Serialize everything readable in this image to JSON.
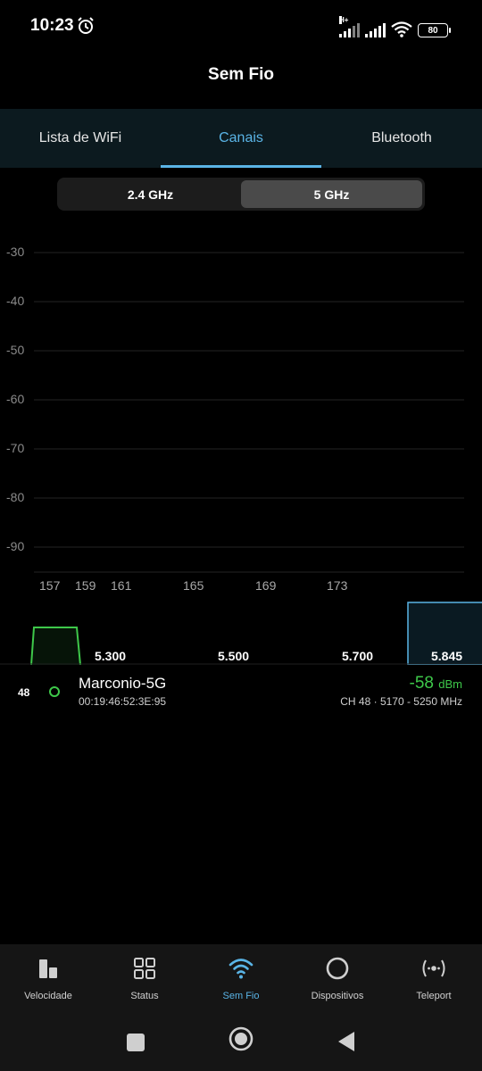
{
  "status_bar": {
    "time": "10:23",
    "network_type": "H+",
    "battery": "80"
  },
  "header": {
    "title": "Sem Fio"
  },
  "tabs": [
    {
      "label": "Lista de WiFi",
      "active": false
    },
    {
      "label": "Canais",
      "active": true
    },
    {
      "label": "Bluetooth",
      "active": false
    }
  ],
  "band_selector": {
    "options": [
      "2.4 GHz",
      "5 GHz"
    ],
    "selected": "5 GHz"
  },
  "chart_data": {
    "type": "area",
    "y_ticks": [
      "-30",
      "-40",
      "-50",
      "-60",
      "-70",
      "-80",
      "-90"
    ],
    "ylim": [
      -95,
      -25
    ],
    "channel_ticks": [
      "157",
      "159",
      "161",
      "165",
      "169",
      "173"
    ],
    "frequency_ticks": [
      "5.300",
      "5.500",
      "5.700",
      "5.845"
    ],
    "series": [
      {
        "channel": 48,
        "signal_dbm": -58,
        "freq_range_mhz": [
          5170,
          5250
        ],
        "color": "#3ec84a"
      }
    ],
    "highlight_color": "#5ab4e6",
    "grid": true
  },
  "networks": [
    {
      "channel": "48",
      "ssid": "Marconio-5G",
      "mac": "00:19:46:52:3E:95",
      "signal": "-58",
      "signal_unit": "dBm",
      "info": "CH 48 · 5170 - 5250 MHz",
      "color": "#3ec84a"
    }
  ],
  "bottom_nav": [
    {
      "label": "Velocidade",
      "icon": "speed-bars-icon",
      "active": false
    },
    {
      "label": "Status",
      "icon": "grid-icon",
      "active": false
    },
    {
      "label": "Sem Fio",
      "icon": "wifi-icon",
      "active": true
    },
    {
      "label": "Dispositivos",
      "icon": "circle-icon",
      "active": false
    },
    {
      "label": "Teleport",
      "icon": "teleport-icon",
      "active": false
    }
  ],
  "accent_color": "#5ab4e6"
}
